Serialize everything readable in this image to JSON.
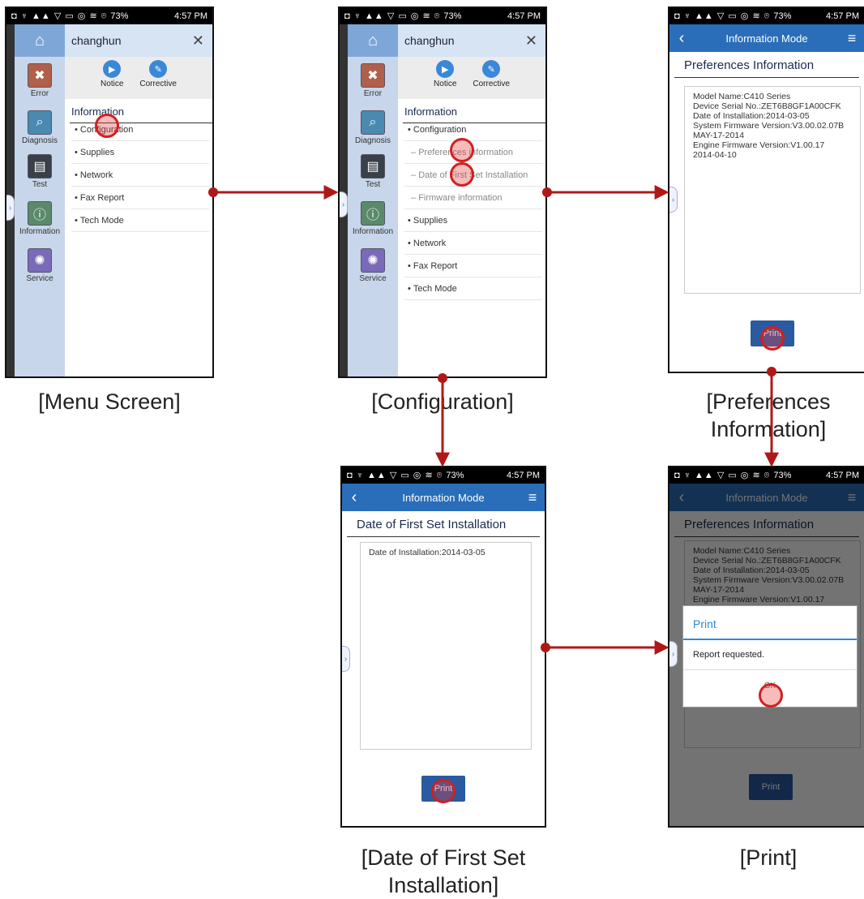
{
  "status_bar": {
    "battery": "73%",
    "time": "4:57 PM"
  },
  "drawer": {
    "user": "changhun",
    "quick": [
      {
        "label": "Notice"
      },
      {
        "label": "Corrective"
      }
    ],
    "rail": [
      {
        "label": "Error"
      },
      {
        "label": "Diagnosis"
      },
      {
        "label": "Test"
      },
      {
        "label": "Information"
      },
      {
        "label": "Service"
      }
    ],
    "section": "Information",
    "menu_items": [
      "Configuration",
      "Supplies",
      "Network",
      "Fax Report",
      "Tech Mode"
    ],
    "config_items": [
      "Configuration",
      "Preferences information",
      "Date of First Set Installation",
      "Firmware information",
      "Supplies",
      "Network",
      "Fax Report",
      "Tech Mode"
    ]
  },
  "info_screen": {
    "appbar_title": "Information Mode",
    "preferences_title": "Preferences Information",
    "preferences_lines": [
      "Model Name:C410 Series",
      "Device Serial No.:ZET6B8GF1A00CFK",
      "Date of Installation:2014-03-05",
      "System Firmware Version:V3.00.02.07B",
      "MAY-17-2014",
      "Engine Firmware Version:V1.00.17",
      "2014-04-10"
    ],
    "date_title": "Date of First Set Installation",
    "date_line": "Date of Installation:2014-03-05",
    "print_label": "Print"
  },
  "dialog": {
    "title": "Print",
    "message": "Report requested.",
    "ok": "OK"
  },
  "captions": {
    "menu": "[Menu Screen]",
    "config": "[Configuration]",
    "prefs_line1": "[Preferences",
    "prefs_line2": "Information]",
    "date_line1": "[Date of First Set",
    "date_line2": "Installation]",
    "print": "[Print]"
  },
  "colors": {
    "arrow": "#b01818",
    "appbar": "#2a6db8"
  }
}
